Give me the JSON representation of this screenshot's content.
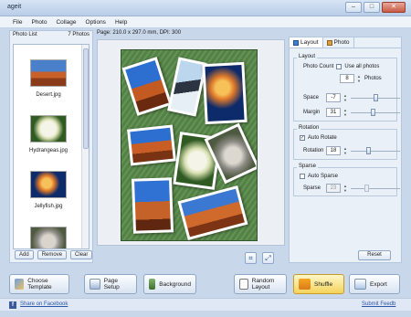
{
  "window": {
    "title": "ageit",
    "min": "–",
    "max": "□",
    "close": "✕"
  },
  "menu": [
    "File",
    "Photo",
    "Collage",
    "Options",
    "Help"
  ],
  "photo_list": {
    "title": "Photo List",
    "count": "7 Photos",
    "items": [
      {
        "name": "Desert.jpg",
        "thumb": "desert"
      },
      {
        "name": "Hydrangeas.jpg",
        "thumb": "hydrangeas"
      },
      {
        "name": "Jellyfish.jpg",
        "thumb": "jellyfish"
      },
      {
        "name": "",
        "thumb": "koala"
      }
    ],
    "add": "Add",
    "remove": "Remove",
    "clear": "Clear"
  },
  "page_info": "Page: 210.0 x 297.0 mm, DPI: 300",
  "tabs": [
    {
      "label": "Layout",
      "icon": "layout-icon"
    },
    {
      "label": "Photo",
      "icon": "photo-icon"
    }
  ],
  "layout": {
    "group": "Layout",
    "photo_count_label": "Photo Count",
    "use_all_label": "Use all photos",
    "use_all_checked": false,
    "photo_count": "8",
    "photos_suffix": "Photos",
    "space_label": "Space",
    "space": "-7",
    "space_slider": 0.5,
    "margin_label": "Margin",
    "margin": "31",
    "margin_slider": 0.45
  },
  "rotation": {
    "group": "Rotation",
    "auto_label": "Auto Rotate",
    "auto_checked": true,
    "rotation_label": "Rotation",
    "rotation": "18",
    "rotation_slider": 0.35
  },
  "sparse": {
    "group": "Sparse",
    "auto_label": "Auto Sparse",
    "auto_checked": false,
    "sparse_label": "Sparse",
    "sparse": "23",
    "sparse_slider": 0.3
  },
  "reset": "Reset",
  "toolbar": {
    "choose_template": "Choose Template",
    "page_setup": "Page Setup",
    "background": "Background",
    "random_layout": "Random Layout",
    "shuffle": "Shuffle",
    "export": "Export"
  },
  "links": {
    "facebook": "Share on Facebook",
    "feedback": "Submit Feedb"
  },
  "colors": {
    "accent": "#3f7fcf",
    "shuffle": "#f5d35a",
    "page_bg": "#5a8c4b"
  }
}
